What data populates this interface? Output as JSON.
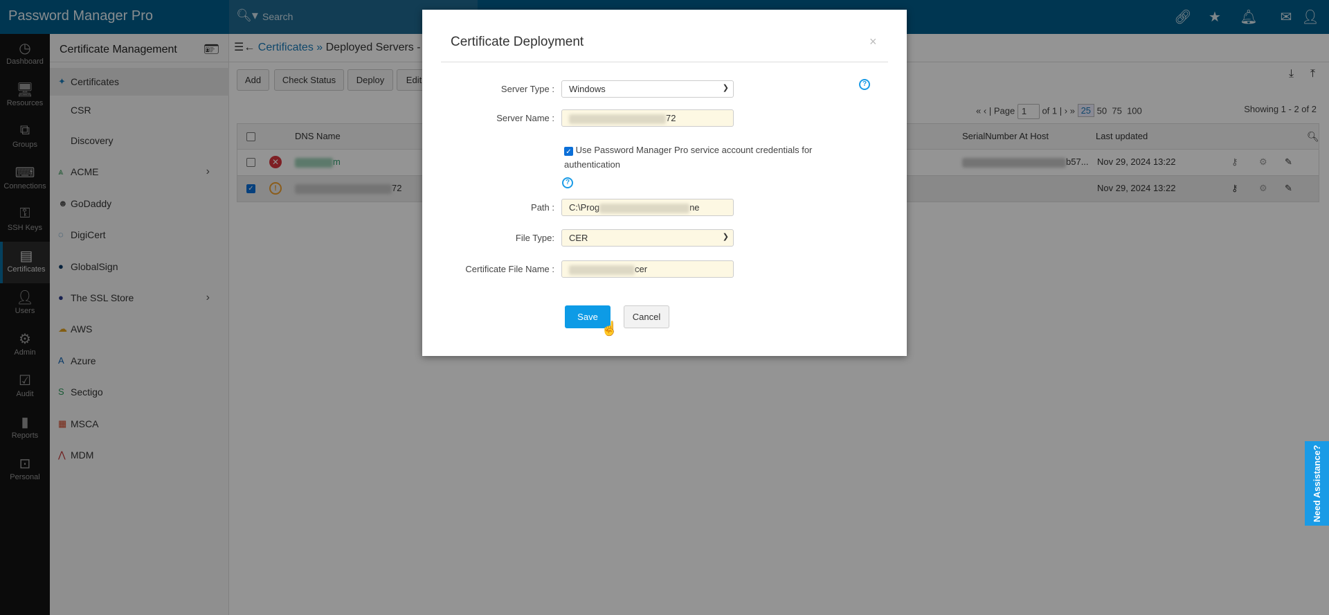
{
  "app": {
    "title": "Password Manager Pro",
    "search_placeholder": "Search"
  },
  "topbar_icons": [
    "link-icon",
    "favorite-user-icon",
    "bell-icon",
    "mail-icon",
    "user-icon"
  ],
  "nav": [
    {
      "label": "Dashboard",
      "icon": "dashboard-icon"
    },
    {
      "label": "Resources",
      "icon": "monitor-icon"
    },
    {
      "label": "Groups",
      "icon": "groups-icon"
    },
    {
      "label": "Connections",
      "icon": "connections-icon"
    },
    {
      "label": "SSH Keys",
      "icon": "ssh-key-icon"
    },
    {
      "label": "Certificates",
      "icon": "certificate-icon",
      "active": true
    },
    {
      "label": "Users",
      "icon": "user-icon"
    },
    {
      "label": "Admin",
      "icon": "gear-icon"
    },
    {
      "label": "Audit",
      "icon": "clipboard-icon"
    },
    {
      "label": "Reports",
      "icon": "bar-chart-icon"
    },
    {
      "label": "Personal",
      "icon": "personal-icon"
    }
  ],
  "sidebar": {
    "title": "Certificate Management",
    "items": [
      {
        "label": "Certificates",
        "active": true
      },
      {
        "label": "CSR"
      },
      {
        "label": "Discovery"
      },
      {
        "label": "ACME",
        "submenu": true
      },
      {
        "label": "GoDaddy"
      },
      {
        "label": "DigiCert"
      },
      {
        "label": "GlobalSign"
      },
      {
        "label": "The SSL Store",
        "submenu": true
      },
      {
        "label": "AWS"
      },
      {
        "label": "Azure"
      },
      {
        "label": "Sectigo"
      },
      {
        "label": "MSCA"
      },
      {
        "label": "MDM"
      }
    ]
  },
  "breadcrumb": {
    "link": "Certificates",
    "sep": " » ",
    "current": "Deployed Servers -"
  },
  "toolbar": {
    "add": "Add",
    "check_status": "Check Status",
    "deploy": "Deploy",
    "edit": "Edit"
  },
  "pagination": {
    "page_label": "Page",
    "page": "1",
    "of": "of 1",
    "sizes": [
      "25",
      "50",
      "75",
      "100"
    ],
    "selected_size": "25",
    "showing": "Showing 1 - 2 of 2"
  },
  "table": {
    "columns": {
      "dns": "DNS Name",
      "serial": "SerialNumber At Host",
      "updated": "Last updated"
    },
    "rows": [
      {
        "dns_suffix": "m",
        "status": "error",
        "serial_suffix": "b57...",
        "updated": "Nov 29, 2024 13:22",
        "checked": false
      },
      {
        "dns_suffix": "72",
        "status": "warning",
        "serial_suffix": "",
        "updated": "Nov 29, 2024 13:22",
        "checked": true
      }
    ]
  },
  "modal": {
    "title": "Certificate Deployment",
    "close": "×",
    "server_type_label": "Server Type :",
    "server_type": "Windows",
    "server_name_label": "Server Name :",
    "server_name_suffix": "72",
    "use_service_account": "Use Password Manager Pro service account credentials for authentication",
    "use_service_account_checked": true,
    "path_label": "Path :",
    "path_prefix": "C:\\Prog",
    "path_suffix": "ne",
    "file_type_label": "File Type:",
    "file_type": "CER",
    "cert_file_label": "Certificate File Name :",
    "cert_file_suffix": "cer",
    "save": "Save",
    "cancel": "Cancel"
  },
  "assist": "Need Assistance?",
  "colors": {
    "topbar": "#005e8c",
    "accent": "#0d9be6",
    "nav": "#141414",
    "error": "#d9363e",
    "warning": "#f0a030"
  }
}
